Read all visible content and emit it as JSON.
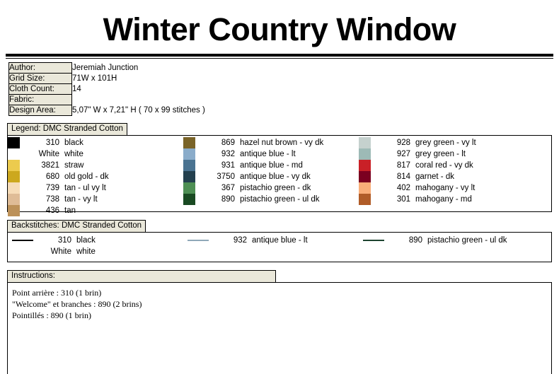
{
  "document": {
    "title": "Winter Country Window"
  },
  "info": {
    "rows": [
      {
        "label": "Author:",
        "value": "Jeremiah Junction"
      },
      {
        "label": "Grid Size:",
        "value": "71W x 101H"
      },
      {
        "label": "Cloth Count:",
        "value": "14"
      },
      {
        "label": "Fabric:",
        "value": ""
      },
      {
        "label": "Design Area:",
        "value": "5,07\" W  x  7,21\" H   ( 70 x 99 stitches )"
      }
    ]
  },
  "legend": {
    "header": "Legend: DMC Stranded Cotton",
    "columns": [
      {
        "entries": [
          {
            "swatch": "#000000",
            "code": "310",
            "name": "black"
          },
          {
            "swatch": "#FFFFFF",
            "code": "White",
            "name": "white"
          },
          {
            "swatch": "#ECCB4E",
            "code": "3821",
            "name": "straw"
          },
          {
            "swatch": "#CCA81E",
            "code": "680",
            "name": "old gold - dk"
          },
          {
            "swatch": "#F6DCB8",
            "code": "739",
            "name": "tan - ul vy lt"
          },
          {
            "swatch": "#DFBC97",
            "code": "738",
            "name": "tan - vy lt"
          },
          {
            "swatch": "#BC9159",
            "code": "436",
            "name": "tan"
          }
        ]
      },
      {
        "entries": [
          {
            "swatch": "#7A6428",
            "code": "869",
            "name": "hazel nut brown - vy dk"
          },
          {
            "swatch": "#8AACCA",
            "code": "932",
            "name": "antique blue - lt"
          },
          {
            "swatch": "#4A7391",
            "code": "931",
            "name": "antique blue - md"
          },
          {
            "swatch": "#23404E",
            "code": "3750",
            "name": "antique blue - vy dk"
          },
          {
            "swatch": "#4E8F54",
            "code": "367",
            "name": "pistachio green - dk"
          },
          {
            "swatch": "#194A22",
            "code": "890",
            "name": "pistachio green - ul dk"
          }
        ]
      },
      {
        "entries": [
          {
            "swatch": "#C5D1CE",
            "code": "928",
            "name": "grey green - vy lt"
          },
          {
            "swatch": "#9DBAB6",
            "code": "927",
            "name": "grey green - lt"
          },
          {
            "swatch": "#C92027",
            "code": "817",
            "name": "coral red - vy dk"
          },
          {
            "swatch": "#7B0020",
            "code": "814",
            "name": "garnet - dk"
          },
          {
            "swatch": "#F9AE79",
            "code": "402",
            "name": "mahogany - vy lt"
          },
          {
            "swatch": "#B05C28",
            "code": "301",
            "name": "mahogany - md"
          }
        ]
      }
    ]
  },
  "backstitches": {
    "header": "Backstitches: DMC Stranded Cotton",
    "columns": [
      {
        "entries": [
          {
            "line_color": "#000000",
            "code": "310",
            "name": "black"
          },
          {
            "line_color": "#FFFFFF",
            "code": "White",
            "name": "white"
          }
        ]
      },
      {
        "entries": [
          {
            "line_color": "#8FA8B8",
            "code": "932",
            "name": "antique blue - lt"
          }
        ]
      },
      {
        "entries": [
          {
            "line_color": "#1E4430",
            "code": "890",
            "name": "pistachio green - ul dk"
          }
        ]
      }
    ]
  },
  "instructions": {
    "header": "Instructions:",
    "lines": [
      "Point arrière : 310 (1 brin)",
      "\"Welcome\" et branches : 890 (2 brins)",
      "Pointillés : 890 (1 brin)"
    ]
  }
}
